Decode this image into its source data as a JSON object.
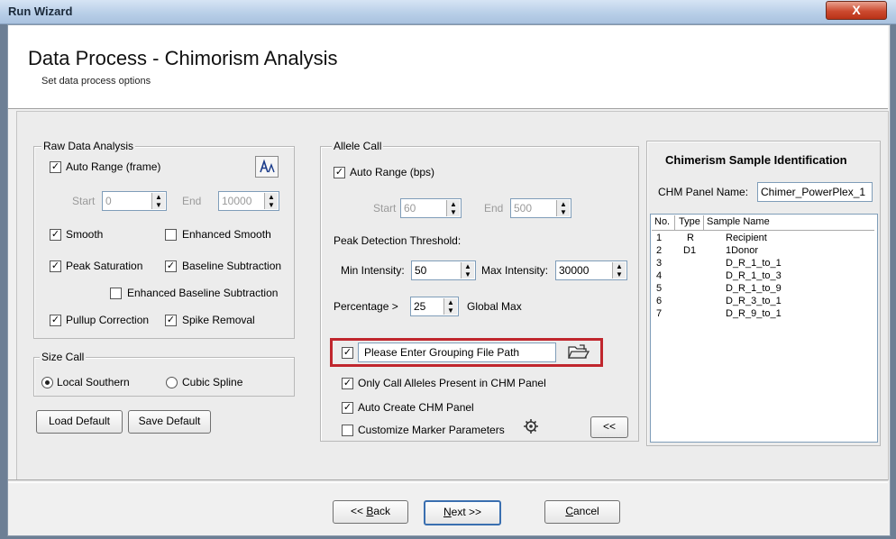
{
  "window": {
    "title": "Run Wizard",
    "close_glyph": "X"
  },
  "header": {
    "title": "Data Process - Chimorism Analysis",
    "subtitle": "Set data process options"
  },
  "raw_data": {
    "legend": "Raw Data Analysis",
    "auto_range": "Auto Range (frame)",
    "start_label": "Start",
    "start_value": "0",
    "end_label": "End",
    "end_value": "10000",
    "smooth": "Smooth",
    "enhanced_smooth": "Enhanced Smooth",
    "peak_saturation": "Peak Saturation",
    "baseline_subtraction": "Baseline Subtraction",
    "enhanced_baseline": "Enhanced Baseline Subtraction",
    "pullup": "Pullup Correction",
    "spike": "Spike Removal"
  },
  "size_call": {
    "legend": "Size Call",
    "local_southern": "Local Southern",
    "cubic_spline": "Cubic Spline"
  },
  "left_buttons": {
    "load_default": "Load Default",
    "save_default": "Save Default"
  },
  "allele_call": {
    "legend": "Allele Call",
    "auto_range": "Auto Range (bps)",
    "start_label": "Start",
    "start_value": "60",
    "end_label": "End",
    "end_value": "500",
    "peak_threshold": "Peak Detection Threshold:",
    "min_intensity_label": "Min Intensity:",
    "min_intensity_value": "50",
    "max_intensity_label": "Max Intensity:",
    "max_intensity_value": "30000",
    "percentage_label": "Percentage >",
    "percentage_value": "25",
    "global_max": "Global Max",
    "grouping_file": "Please Enter Grouping File Path",
    "only_call": "Only Call Alleles Present in CHM Panel",
    "auto_create": "Auto Create CHM Panel",
    "customize": "Customize Marker Parameters",
    "collapse_button": "<<"
  },
  "chimerism": {
    "title": "Chimerism Sample Identification",
    "panel_name_label": "CHM Panel Name:",
    "panel_name_value": "Chimer_PowerPlex_1",
    "columns": {
      "no": "No.",
      "type": "Type",
      "sample": "Sample Name"
    },
    "rows": [
      {
        "no": "1",
        "type": "R",
        "sample": "Recipient"
      },
      {
        "no": "2",
        "type": "D1",
        "sample": "1Donor"
      },
      {
        "no": "3",
        "type": "",
        "sample": "D_R_1_to_1"
      },
      {
        "no": "4",
        "type": "",
        "sample": "D_R_1_to_3"
      },
      {
        "no": "5",
        "type": "",
        "sample": "D_R_1_to_9"
      },
      {
        "no": "6",
        "type": "",
        "sample": "D_R_3_to_1"
      },
      {
        "no": "7",
        "type": "",
        "sample": "D_R_9_to_1"
      }
    ]
  },
  "footer": {
    "back_pre": "<< ",
    "back_key": "B",
    "back_post": "ack",
    "next_key": "N",
    "next_post": "ext >>",
    "cancel_key": "C",
    "cancel_post": "ancel"
  },
  "colors": {
    "highlight": "#c0262d",
    "title_gradient": "#b9cfe8",
    "close_button": "#cc4a2f"
  },
  "icons": {
    "auto_range_tool": "text-size-icon",
    "browse": "folder-open-icon",
    "customize": "settings-icon"
  }
}
